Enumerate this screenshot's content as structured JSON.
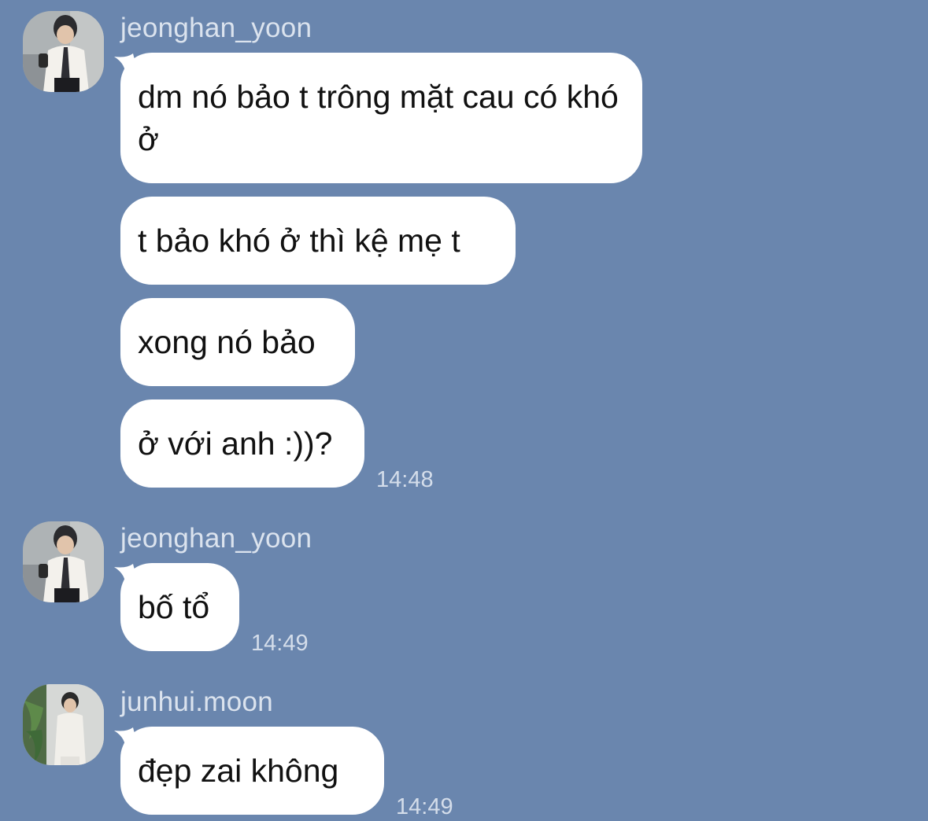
{
  "messages": [
    {
      "sender": "jeonghan_yoon",
      "avatar_icon": "profile-photo-icon",
      "bubbles": [
        "dm nó bảo t trông mặt cau có khó ở",
        "t bảo khó ở thì kệ mẹ t",
        "xong nó bảo",
        "ở với anh :))?"
      ],
      "time": "14:48"
    },
    {
      "sender": "jeonghan_yoon",
      "avatar_icon": "profile-photo-icon",
      "bubbles": [
        "bố tổ"
      ],
      "time": "14:49"
    },
    {
      "sender": "junhui.moon",
      "avatar_icon": "profile-photo-icon",
      "bubbles": [
        "đẹp zai không"
      ],
      "time": "14:49"
    }
  ],
  "colors": {
    "background": "#6a86ae",
    "bubble": "#ffffff",
    "meta_text": "#dbe3ee"
  }
}
